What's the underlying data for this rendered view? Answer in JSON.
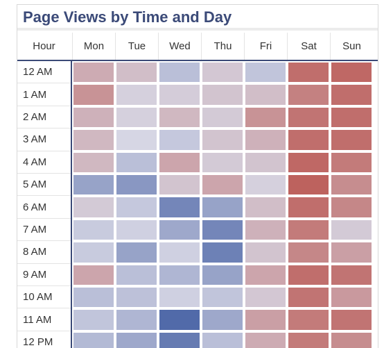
{
  "title": "Page Views by Time and Day",
  "chart_data": {
    "type": "heatmap",
    "title": "Page Views by Time and Day",
    "row_header": "Hour",
    "columns": [
      "Mon",
      "Tue",
      "Wed",
      "Thu",
      "Fri",
      "Sat",
      "Sun"
    ],
    "rows": [
      "12 AM",
      "1 AM",
      "2 AM",
      "3 AM",
      "4 AM",
      "5 AM",
      "6 AM",
      "7 AM",
      "8 AM",
      "9 AM",
      "10 AM",
      "11 AM",
      "12 PM"
    ],
    "values": [
      [
        0.35,
        0.2,
        -0.2,
        0.12,
        -0.15,
        0.85,
        0.9
      ],
      [
        0.55,
        0.05,
        0.08,
        0.15,
        0.2,
        0.7,
        0.85
      ],
      [
        0.3,
        0.05,
        0.25,
        0.1,
        0.55,
        0.8,
        0.85
      ],
      [
        0.25,
        0.0,
        -0.12,
        0.15,
        0.3,
        0.85,
        0.85
      ],
      [
        0.25,
        -0.2,
        0.4,
        0.1,
        0.15,
        0.9,
        0.75
      ],
      [
        -0.45,
        -0.55,
        0.15,
        0.4,
        0.05,
        0.95,
        0.6
      ],
      [
        0.1,
        -0.12,
        -0.7,
        -0.45,
        0.2,
        0.85,
        0.65
      ],
      [
        -0.1,
        -0.05,
        -0.4,
        -0.7,
        0.3,
        0.75,
        0.1
      ],
      [
        -0.1,
        -0.45,
        -0.05,
        -0.75,
        0.15,
        0.65,
        0.45
      ],
      [
        0.4,
        -0.2,
        -0.28,
        -0.45,
        0.4,
        0.85,
        0.8
      ],
      [
        -0.2,
        -0.18,
        -0.05,
        -0.15,
        0.12,
        0.8,
        0.5
      ],
      [
        -0.15,
        -0.28,
        -0.95,
        -0.4,
        0.45,
        0.75,
        0.8
      ],
      [
        -0.25,
        -0.4,
        -0.8,
        -0.2,
        0.35,
        0.75,
        0.6
      ]
    ],
    "color_scale": {
      "low": "#4a64a6",
      "mid": "#d6d6e4",
      "high": "#bc5c57"
    }
  }
}
